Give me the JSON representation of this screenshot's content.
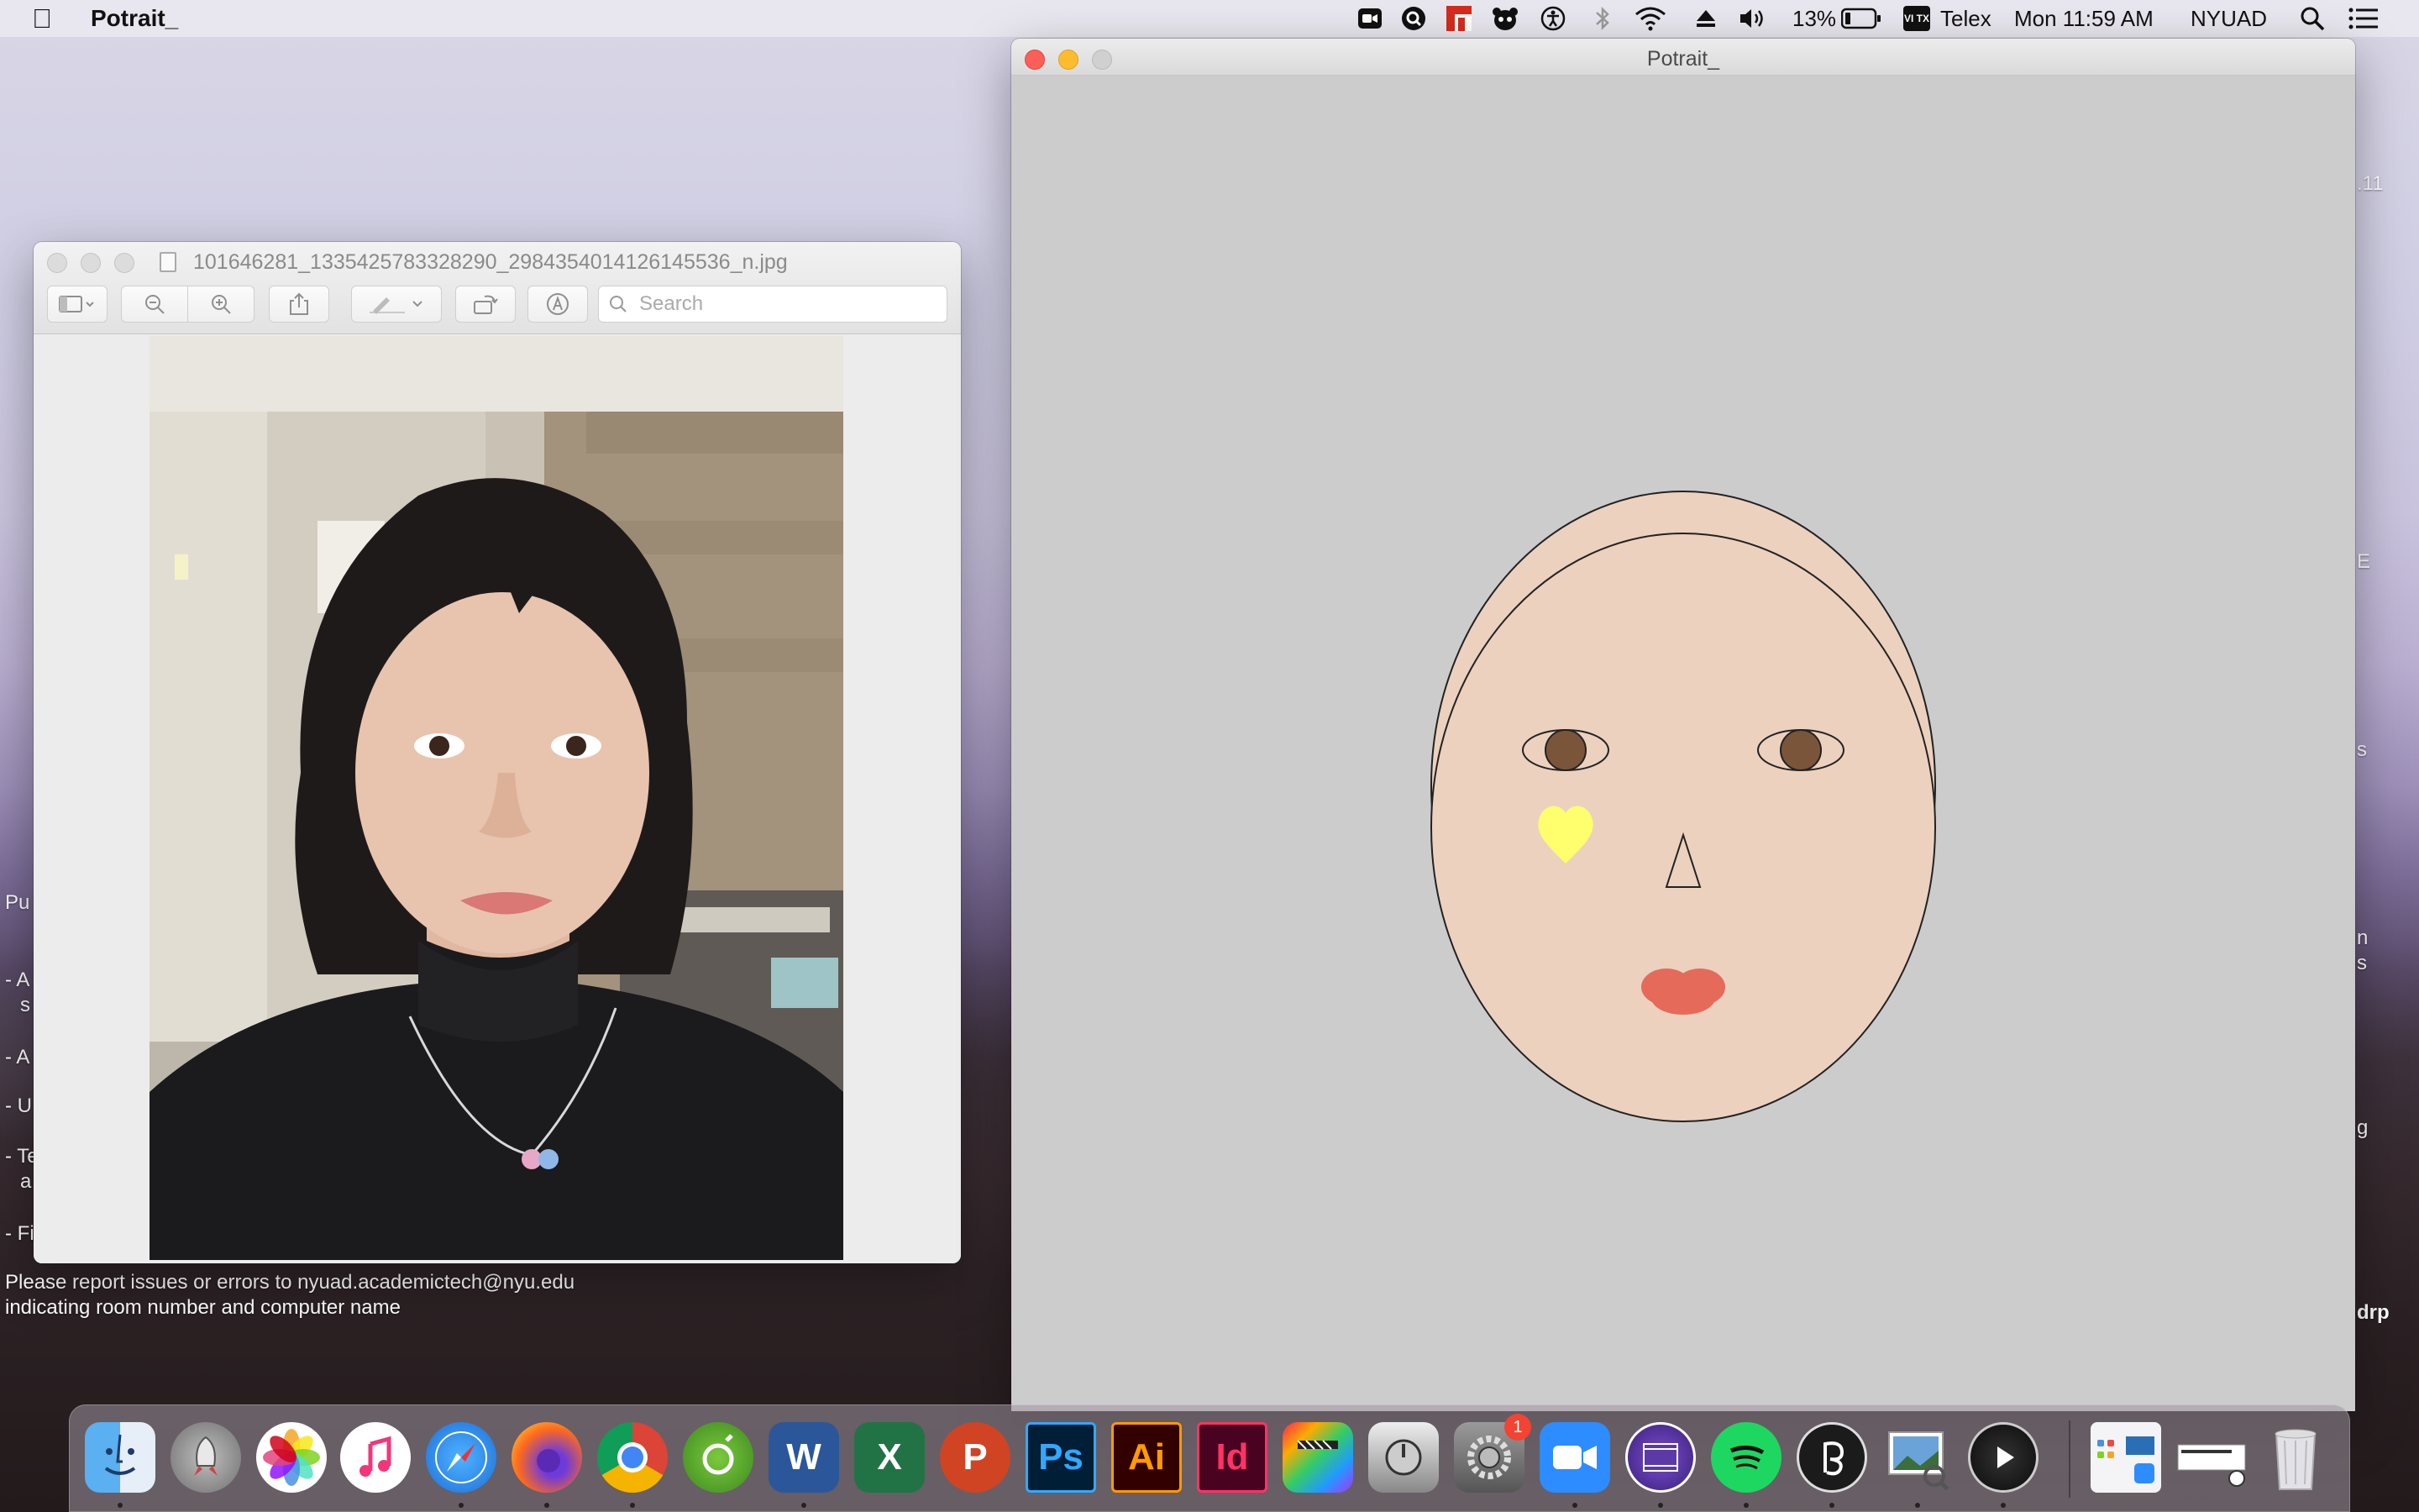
{
  "menubar": {
    "app_name": "Potrait_",
    "battery_percent": "13%",
    "input_source_badge": "VI TX",
    "input_source": "Telex",
    "clock": "Mon 11:59 AM",
    "user": "NYUAD",
    "icons": [
      "apple-icon",
      "zoom-meeting-icon",
      "quicksilver-icon",
      "adobe-icon",
      "panda-icon",
      "accessibility-icon",
      "bluetooth-icon",
      "wifi-icon",
      "eject-icon",
      "volume-icon",
      "battery-icon",
      "spotlight-icon",
      "notification-center-icon"
    ]
  },
  "preview_window": {
    "title": "101646281_1335425783328290_2984354014126145536_n.jpg",
    "search_placeholder": "Search",
    "toolbar": [
      "sidebar-toggle",
      "zoom-out",
      "zoom-in",
      "share",
      "markup",
      "rotate",
      "annotate"
    ]
  },
  "portrait_window": {
    "title": "Potrait_",
    "face_colors": {
      "skin": "#ecd1bf",
      "iris": "#7a553a",
      "heart": "#ffff6e",
      "lips": "#e56a5a"
    }
  },
  "desktop": {
    "notice_line1": "Please report issues or errors to nyuad.academictech@nyu.edu",
    "notice_line2": "indicating room number and computer name",
    "left_fragments": [
      "Pu",
      "- A",
      "s",
      "- A",
      "- U",
      "- Te",
      "a",
      "- Fi"
    ],
    "right_fragments": [
      ".11",
      "E",
      "s",
      "n",
      "s",
      "g",
      "drp"
    ]
  },
  "dock": {
    "apps": [
      "Finder",
      "Launchpad",
      "Photos",
      "Music",
      "Safari",
      "Firefox",
      "Chrome",
      "Growl",
      "Word",
      "Excel",
      "PowerPoint",
      "Photoshop",
      "Illustrator",
      "InDesign",
      "Final Cut Pro",
      "Logic Pro",
      "System Preferences",
      "Zoom",
      "Screen Recorder",
      "Spotify",
      "Processing",
      "Preview",
      "Movie Player",
      "Apps Folder",
      "Screenshot",
      "Trash"
    ],
    "word_label": "W",
    "excel_label": "X",
    "ppt_label": "P",
    "ps_label": "Ps",
    "ai_label": "Ai",
    "id_label": "Id",
    "sysprefs_badge": "1"
  }
}
